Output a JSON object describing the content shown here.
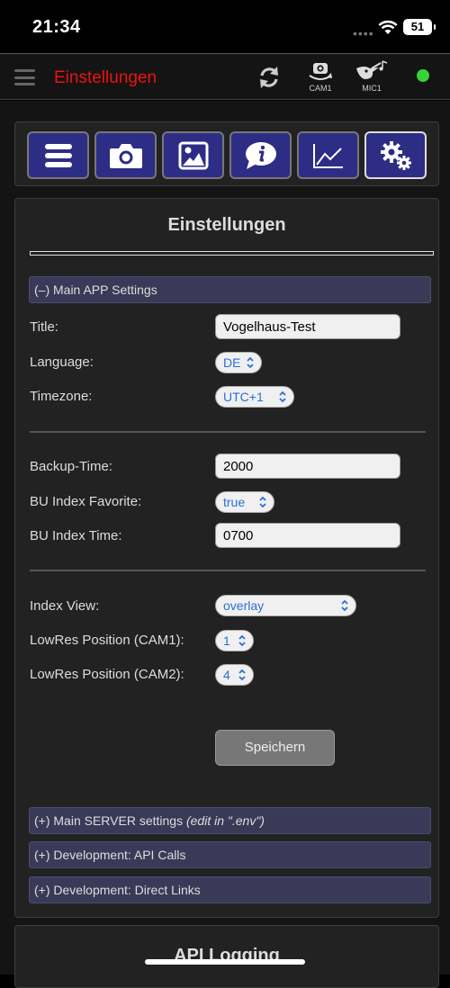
{
  "status_bar": {
    "time": "21:34",
    "battery": "51"
  },
  "nav": {
    "title": "Einstellungen",
    "cam_label": "CAM1",
    "mic_label": "MIC1",
    "status_color": "#35d43a"
  },
  "icon_bar": {
    "buttons": [
      {
        "name": "list-icon"
      },
      {
        "name": "camera-icon"
      },
      {
        "name": "image-icon"
      },
      {
        "name": "info-icon"
      },
      {
        "name": "chart-icon"
      },
      {
        "name": "gears-icon",
        "active": true
      }
    ]
  },
  "settings": {
    "title": "Einstellungen",
    "main_app_header": "(–) Main APP Settings",
    "fields": {
      "title_label": "Title:",
      "title_value": "Vogelhaus-Test",
      "language_label": "Language:",
      "language_value": "DE",
      "timezone_label": "Timezone:",
      "timezone_value": "UTC+1",
      "backup_time_label": "Backup-Time:",
      "backup_time_value": "2000",
      "bu_index_favorite_label": "BU Index Favorite:",
      "bu_index_favorite_value": "true",
      "bu_index_time_label": "BU Index Time:",
      "bu_index_time_value": "0700",
      "index_view_label": "Index View:",
      "index_view_value": "overlay",
      "lowres_cam1_label": "LowRes Position (CAM1):",
      "lowres_cam1_value": "1",
      "lowres_cam2_label": "LowRes Position (CAM2):",
      "lowres_cam2_value": "4"
    },
    "save_label": "Speichern",
    "server_header": "(+) Main SERVER settings ",
    "server_header_note": "(edit in \".env\")",
    "api_calls_header": "(+) Development: API Calls",
    "direct_links_header": "(+) Development: Direct Links"
  },
  "api_logging": {
    "title": "API Logging"
  },
  "colors": {
    "accent": "#2d2d86",
    "nav_title": "#e11111",
    "select_text": "#2b6fd6"
  }
}
